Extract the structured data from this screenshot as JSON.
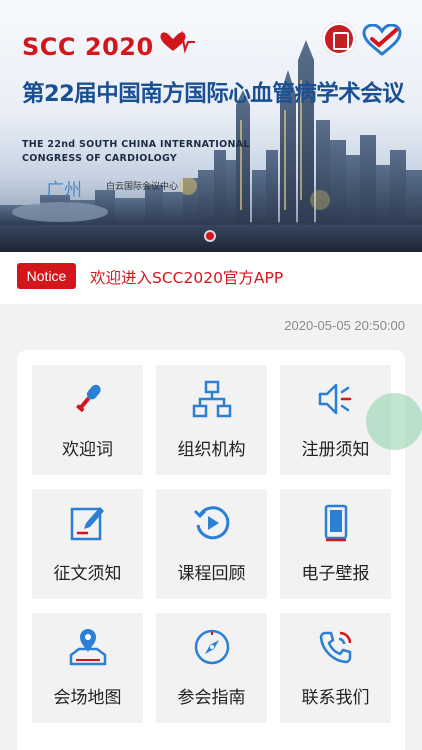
{
  "banner": {
    "logo_text": "SCC 2020",
    "title_cn": "第22届中国南方国际心血管病学术会议",
    "title_en_line1": "THE 22nd SOUTH CHINA INTERNATIONAL",
    "title_en_line2": "CONGRESS OF CARDIOLOGY",
    "city_text": "广州",
    "venue_text": "白云国际会议中心",
    "brand_color": "#d4161c"
  },
  "notice": {
    "badge": "Notice",
    "text": "欢迎进入SCC2020官方APP"
  },
  "datetime": "2020-05-05 20:50:00",
  "menu": {
    "items": [
      {
        "label": "欢迎词",
        "icon": "microphone-icon"
      },
      {
        "label": "组织机构",
        "icon": "org-chart-icon"
      },
      {
        "label": "注册须知",
        "icon": "speaker-icon"
      },
      {
        "label": "征文须知",
        "icon": "edit-document-icon"
      },
      {
        "label": "课程回顾",
        "icon": "replay-icon"
      },
      {
        "label": "电子壁报",
        "icon": "tablet-icon"
      },
      {
        "label": "会场地图",
        "icon": "map-pin-icon"
      },
      {
        "label": "参会指南",
        "icon": "compass-icon"
      },
      {
        "label": "联系我们",
        "icon": "phone-icon"
      }
    ]
  },
  "colors": {
    "icon_blue": "#2b7fd4",
    "accent_red": "#d4161c"
  }
}
